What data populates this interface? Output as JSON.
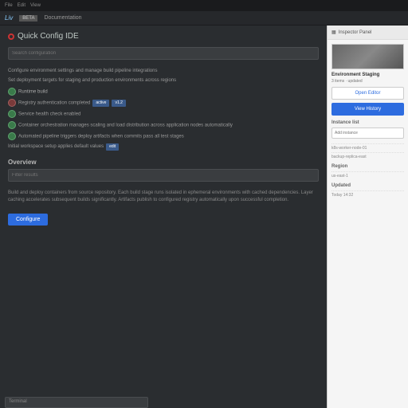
{
  "top": {
    "items": [
      "File",
      "Edit",
      "View"
    ]
  },
  "hdr": {
    "logo": "Liv",
    "badge": "BETA",
    "crumb": "Documentation"
  },
  "main": {
    "title": "Quick Config IDE",
    "input1_ph": "Search configuration",
    "ln1": "Configure environment settings and manage build pipeline integrations",
    "ln2": "Set deployment targets for staging and production environments across regions",
    "ln3": "Runtime build",
    "ln4": "Registry authentication completed",
    "tag1": "active",
    "tag2": "v1.2",
    "ln5": "Service health check enabled",
    "ln6": "Container orchestration manages scaling and load distribution across application nodes automatically",
    "ln7": "Automated pipeline triggers deploy artifacts when commits pass all test stages",
    "ln8": "Initial workspace setup applies default values",
    "tag3": "edit",
    "sec": "Overview",
    "input2_ph": "Filter results",
    "para": "Build and deploy containers from source repository. Each build stage runs isolated in ephemeral environments with cached dependencies. Layer caching accelerates subsequent builds significantly. Artifacts publish to configured registry automatically upon successful completion.",
    "btn": "Configure"
  },
  "side": {
    "hdr_icon": "grid",
    "hdr": "Inspector Panel",
    "title": "Environment Staging",
    "sub": "3 items · updated",
    "btn1": "Open Editor",
    "btn2": "View History",
    "sec1": "Instance list",
    "inp1_ph": "Add instance",
    "l1": "k8s-worker-node-01",
    "l2": "backup-replica-east",
    "sec2": "Region",
    "l3": "us-east-1",
    "sec3": "Updated",
    "l4": "Today 14:32"
  },
  "bottom_ph": "Terminal"
}
